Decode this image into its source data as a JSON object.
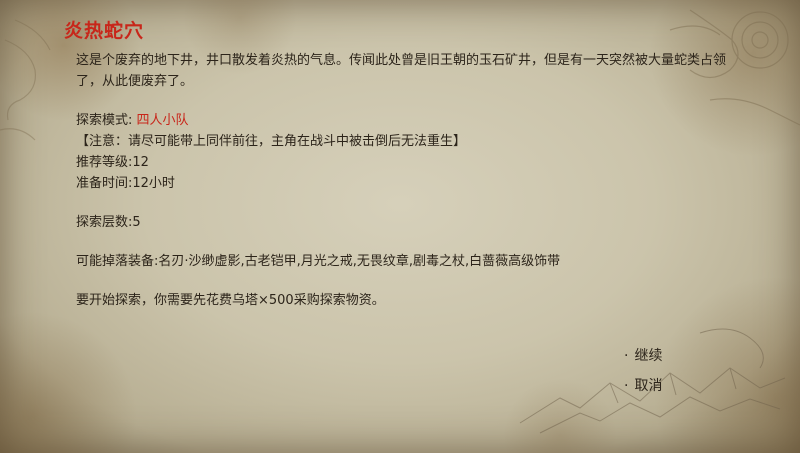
{
  "dialog": {
    "title": "炎热蛇穴",
    "description": "这是个废弃的地下井，井口散发着炎热的气息。传闻此处曾是旧王朝的玉石矿井，但是有一天突然被大量蛇类占领了，从此便废弃了。",
    "mode_label": "探索模式:",
    "mode_value": "四人小队",
    "notice": "【注意：请尽可能带上同伴前往，主角在战斗中被击倒后无法重生】",
    "level_line": "推荐等级:12",
    "time_line": "准备时间:12小时",
    "floors_line": "探索层数:5",
    "drops_line": "可能掉落装备:名刃·沙缈虚影,古老铠甲,月光之戒,无畏纹章,剧毒之杖,白蔷薇高级饰带",
    "cost_line": "要开始探索，你需要先花费乌塔×500采购探索物资。"
  },
  "menu": {
    "bullet": "·",
    "continue_label": "继续",
    "cancel_label": "取消"
  },
  "colors": {
    "title": "#c8261a",
    "highlight": "#c8261a",
    "text": "#2c241a",
    "parchment": "#cbc4ab"
  }
}
